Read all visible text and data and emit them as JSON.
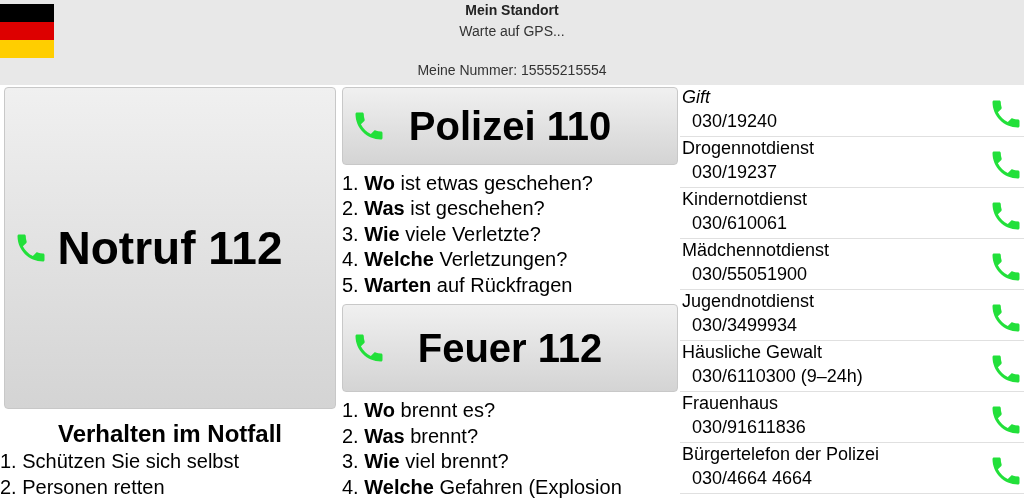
{
  "header": {
    "title": "Mein Standort",
    "status": "Warte auf GPS...",
    "my_number": "Meine Nummer: 15555215554"
  },
  "emergency_button": {
    "label": "Notruf 112"
  },
  "guide": {
    "title": "Verhalten im Notfall",
    "items": [
      "1. Schützen Sie sich selbst",
      "2. Personen retten"
    ]
  },
  "police_button": {
    "label": "Polizei 110"
  },
  "police_questions": [
    "1. **Wo** ist etwas geschehen?",
    "2. **Was** ist geschehen?",
    "3. **Wie** viele Verletzte?",
    "4. **Welche** Verletzungen?",
    "5. **Warten** auf Rückfragen"
  ],
  "fire_button": {
    "label": "Feuer 112"
  },
  "fire_questions": [
    "1. **Wo** brennt es?",
    "2. **Was** brennt?",
    "3. **Wie** viel brennt?",
    "4. **Welche** Gefahren (Explosion"
  ],
  "contacts": [
    {
      "name": "Gift",
      "number": "030/19240",
      "italic": true
    },
    {
      "name": "Drogennotdienst",
      "number": "030/19237",
      "italic": false
    },
    {
      "name": "Kindernotdienst",
      "number": "030/610061",
      "italic": false
    },
    {
      "name": "Mädchennotdienst",
      "number": "030/55051900",
      "italic": false
    },
    {
      "name": "Jugendnotdienst",
      "number": "030/3499934",
      "italic": false
    },
    {
      "name": "Häusliche Gewalt",
      "number": "030/6110300 (9–24h)",
      "italic": false
    },
    {
      "name": "Frauenhaus",
      "number": "030/91611836",
      "italic": false
    },
    {
      "name": "Bürgertelefon der Polizei",
      "number": "030/4664 4664",
      "italic": false
    }
  ]
}
